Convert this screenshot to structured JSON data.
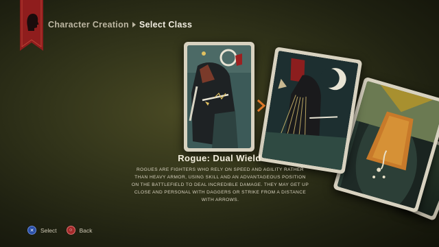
{
  "breadcrumb": {
    "parent": "Character Creation",
    "current": "Select Class"
  },
  "class": {
    "title": "Rogue: Dual Wield",
    "description": "Rogues are fighters who rely on speed and agility rather than heavy armor, using skill and an advantageous position on the battlefield to deal incredible damage. They may get up close and personal with daggers or strike from a distance with arrows."
  },
  "footer": {
    "select_label": "Select",
    "back_label": "Back"
  },
  "colors": {
    "banner": "#8f1d1d",
    "accent_arrow": "#e07a2a",
    "select_button": "#2a4fa6",
    "back_button": "#a22a2a"
  },
  "icons": {
    "banner_emblem": "head-silhouette-icon",
    "next": "chevron-right-icon",
    "select": "cross-button-icon",
    "back": "circle-button-icon"
  }
}
